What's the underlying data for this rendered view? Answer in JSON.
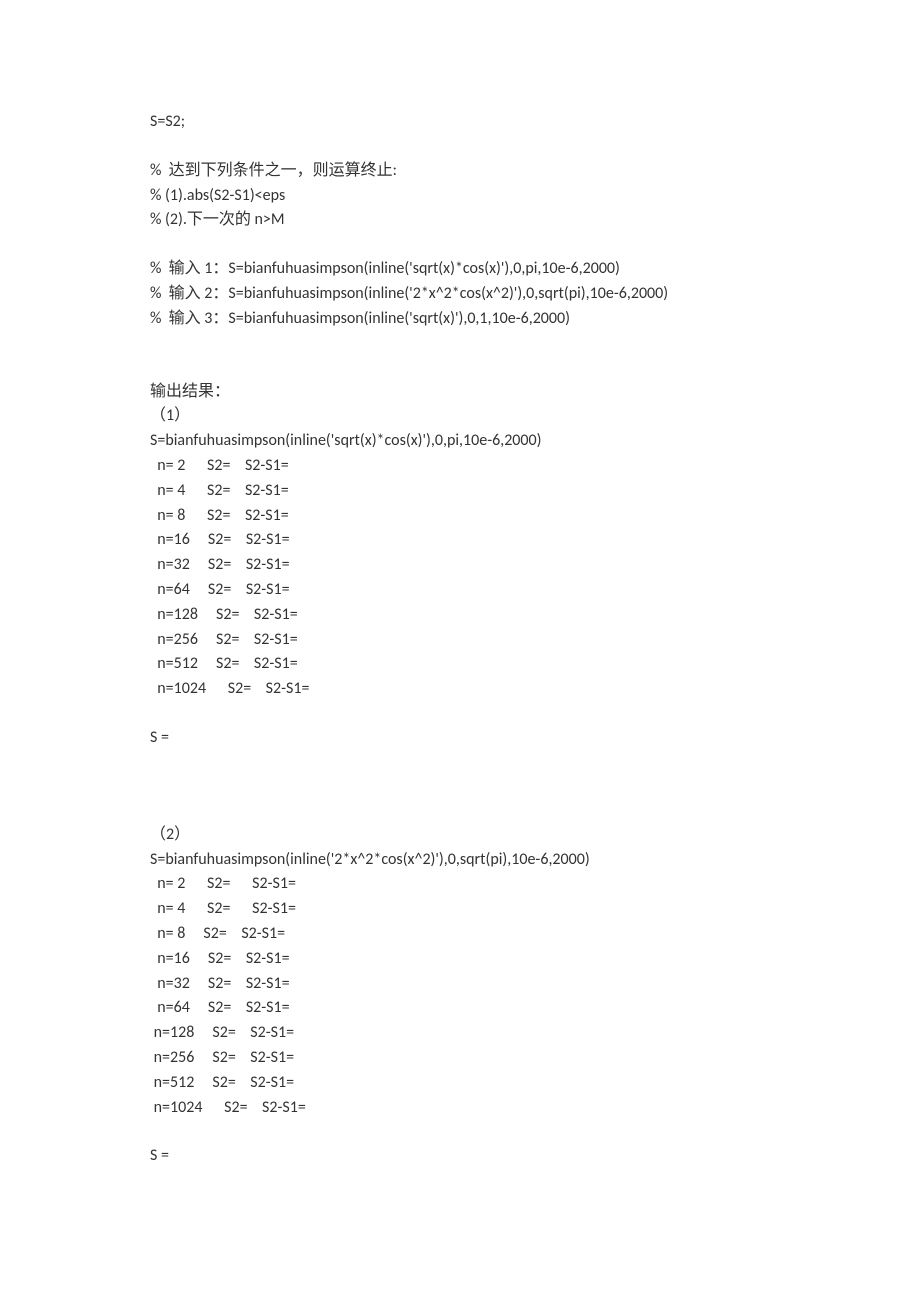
{
  "lines": [
    "S=S2;",
    "",
    "%  达到下列条件之一，则运算终止:",
    "% (1).abs(S2-S1)<eps",
    "% (2).下一次的 n>M",
    "",
    "%  输入 1：S=bianfuhuasimpson(inline('sqrt(x)*cos(x)'),0,pi,10e-6,2000)",
    "%  输入 2：S=bianfuhuasimpson(inline('2*x^2*cos(x^2)'),0,sqrt(pi),10e-6,2000)",
    "%  输入 3：S=bianfuhuasimpson(inline('sqrt(x)'),0,1,10e-6,2000)",
    "",
    "",
    "输出结果：",
    "（1）",
    "S=bianfuhuasimpson(inline('sqrt(x)*cos(x)'),0,pi,10e-6,2000)",
    "  n= 2      S2=    S2-S1=",
    "  n= 4      S2=    S2-S1=",
    "  n= 8      S2=    S2-S1=",
    "  n=16     S2=    S2-S1=",
    "  n=32     S2=    S2-S1=",
    "  n=64     S2=    S2-S1=",
    "  n=128     S2=    S2-S1=",
    "  n=256     S2=    S2-S1=",
    "  n=512     S2=    S2-S1=",
    "  n=1024      S2=    S2-S1=",
    "",
    "S =",
    "",
    "",
    "",
    "（2）",
    "S=bianfuhuasimpson(inline('2*x^2*cos(x^2)'),0,sqrt(pi),10e-6,2000)",
    "  n= 2      S2=      S2-S1=",
    "  n= 4      S2=      S2-S1=",
    "  n= 8     S2=    S2-S1=",
    "  n=16     S2=    S2-S1=",
    "  n=32     S2=    S2-S1=",
    "  n=64     S2=    S2-S1=",
    " n=128     S2=    S2-S1=",
    " n=256     S2=    S2-S1=",
    " n=512     S2=    S2-S1=",
    " n=1024      S2=    S2-S1=",
    "",
    "S ="
  ]
}
